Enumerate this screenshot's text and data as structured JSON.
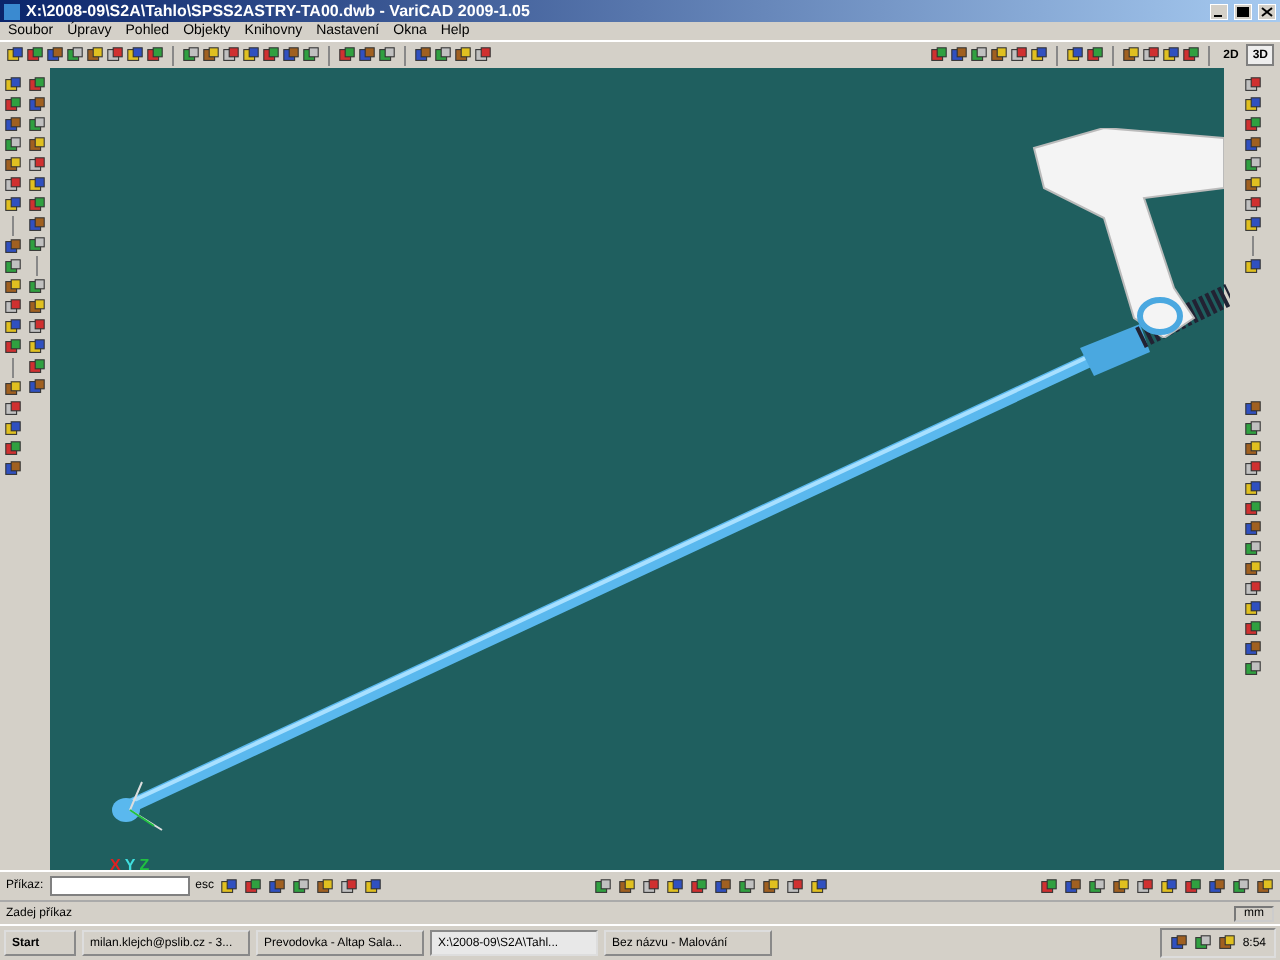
{
  "window": {
    "title": "X:\\2008-09\\S2A\\Tahlo\\SPSS2ASTRY-TA00.dwb - VariCAD 2009-1.05"
  },
  "menu": [
    "Soubor",
    "Úpravy",
    "Pohled",
    "Objekty",
    "Knihovny",
    "Nastavení",
    "Okna",
    "Help"
  ],
  "view_buttons": [
    {
      "label": "2D",
      "selected": false
    },
    {
      "label": "3D",
      "selected": true
    }
  ],
  "axes": [
    {
      "label": "X",
      "color": "#e02020"
    },
    {
      "label": "Y",
      "color": "#40e0e0"
    },
    {
      "label": "Z",
      "color": "#20c040"
    }
  ],
  "command": {
    "label": "Příkaz:",
    "esc": "esc"
  },
  "status": {
    "prompt": "Zadej příkaz",
    "units": "mm"
  },
  "taskbar": {
    "start": "Start",
    "tasks": [
      {
        "label": "milan.klejch@pslib.cz - 3...",
        "selected": false
      },
      {
        "label": "Prevodovka - Altap Sala...",
        "selected": false
      },
      {
        "label": "X:\\2008-09\\S2A\\Tahl...",
        "selected": true
      },
      {
        "label": "Bez názvu - Malování",
        "selected": false
      }
    ],
    "clock": "8:54"
  }
}
